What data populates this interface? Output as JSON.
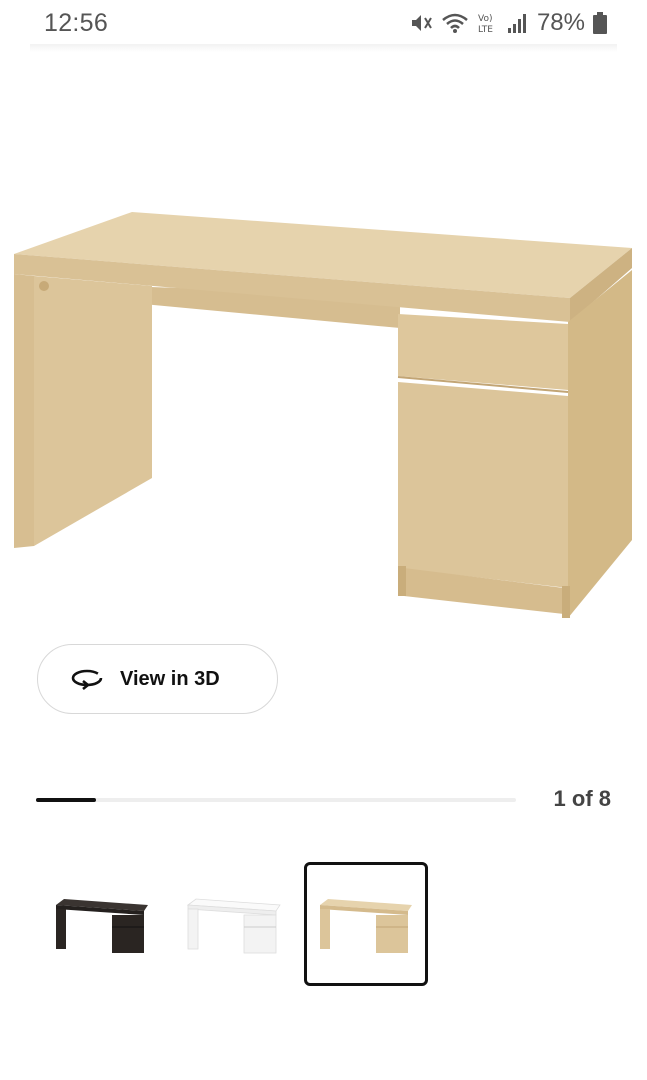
{
  "status_bar": {
    "time": "12:56",
    "battery_text": "78%",
    "icons": [
      "mute-icon",
      "wifi-icon",
      "volte-icon",
      "signal-icon",
      "battery-icon"
    ]
  },
  "product": {
    "image": "desk-image"
  },
  "view_3d": {
    "label": "View in 3D",
    "icon": "rotate-3d-icon"
  },
  "carousel": {
    "counter": "1 of 8",
    "current": 1,
    "total": 8
  },
  "variants": [
    {
      "name": "black-brown",
      "color": "#2a2522",
      "selected": false
    },
    {
      "name": "white",
      "color": "#f3f3f3",
      "selected": false
    },
    {
      "name": "white-stained-oak",
      "color": "#dcc49a",
      "selected": true
    }
  ],
  "colors": {
    "oak_top": "#e4d0a8",
    "oak_front": "#dcc59a",
    "oak_side": "#d2b888",
    "oak_dark": "#c7aa78"
  }
}
